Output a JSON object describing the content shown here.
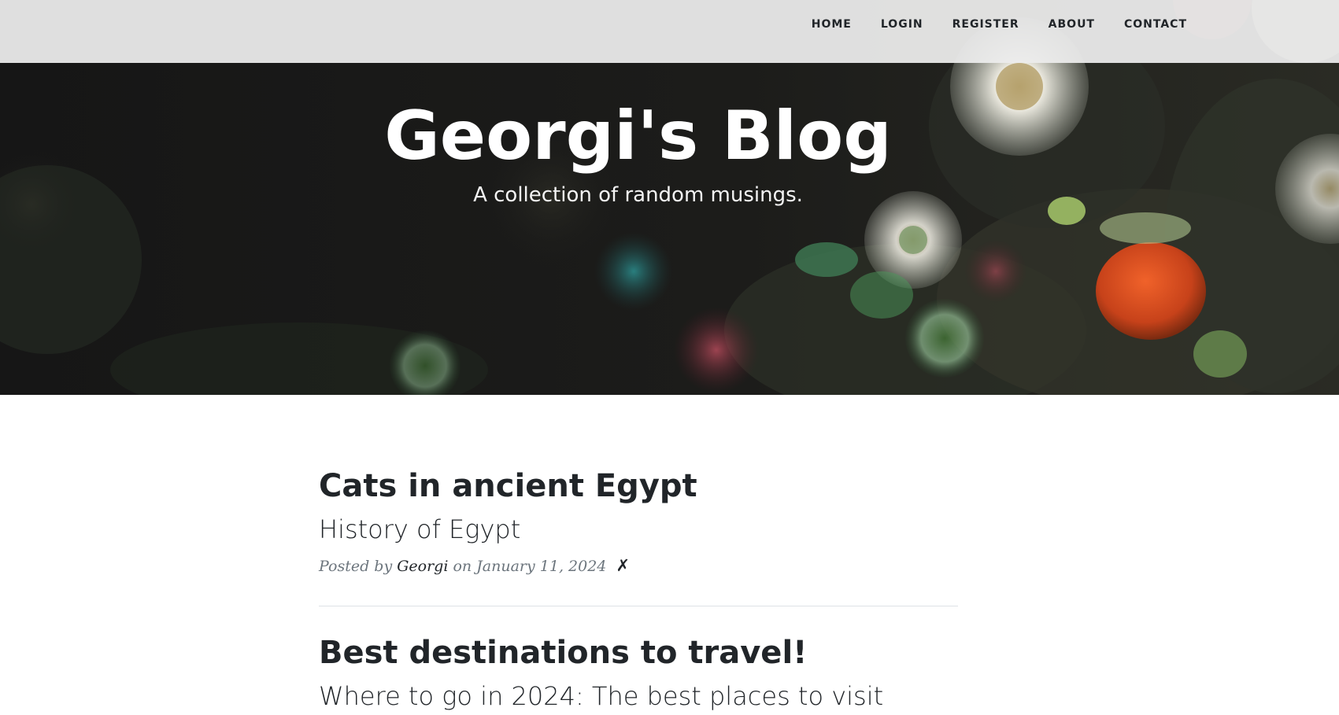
{
  "nav": {
    "items": [
      {
        "label": "HOME"
      },
      {
        "label": "LOGIN"
      },
      {
        "label": "REGISTER"
      },
      {
        "label": "ABOUT"
      },
      {
        "label": "CONTACT"
      }
    ]
  },
  "header": {
    "title": "Georgi's Blog",
    "subtitle": "A collection of random musings."
  },
  "posts": [
    {
      "title": "Cats in ancient Egypt",
      "subtitle": "History of Egypt",
      "meta_prefix": "Posted by",
      "author": "Georgi",
      "meta_date": "on January 11, 2024",
      "delete_symbol": "✗"
    },
    {
      "title": "Best destinations to travel!",
      "subtitle": "Where to go in 2024: The best places to visit"
    }
  ],
  "colors": {
    "text": "#212529",
    "meta": "#6c757d",
    "nav_bg": "#ececec",
    "hero_bg": "#1c1c1b"
  }
}
